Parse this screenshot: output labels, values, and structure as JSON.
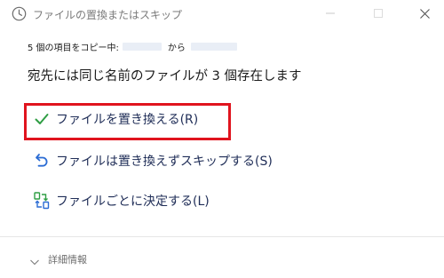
{
  "window": {
    "title": "ファイルの置換またはスキップ"
  },
  "copy_status": {
    "prefix": "5 個の項目をコピー中:",
    "connector": "から"
  },
  "headline": "宛先には同じ名前のファイルが 3 個存在します",
  "options": {
    "replace": {
      "label": "ファイルを置き換える(R)",
      "icon": "checkmark-icon",
      "color": "#2f9e44"
    },
    "skip": {
      "label": "ファイルは置き換えずスキップする(S)",
      "icon": "undo-arrow-icon",
      "color": "#2b6cd4"
    },
    "decide": {
      "label": "ファイルごとに決定する(L)",
      "icon": "compare-files-icon",
      "color": "#2b6cd4"
    }
  },
  "highlight_color": "#e0141e",
  "details": {
    "label": "詳細情報",
    "icon": "chevron-down-icon"
  }
}
